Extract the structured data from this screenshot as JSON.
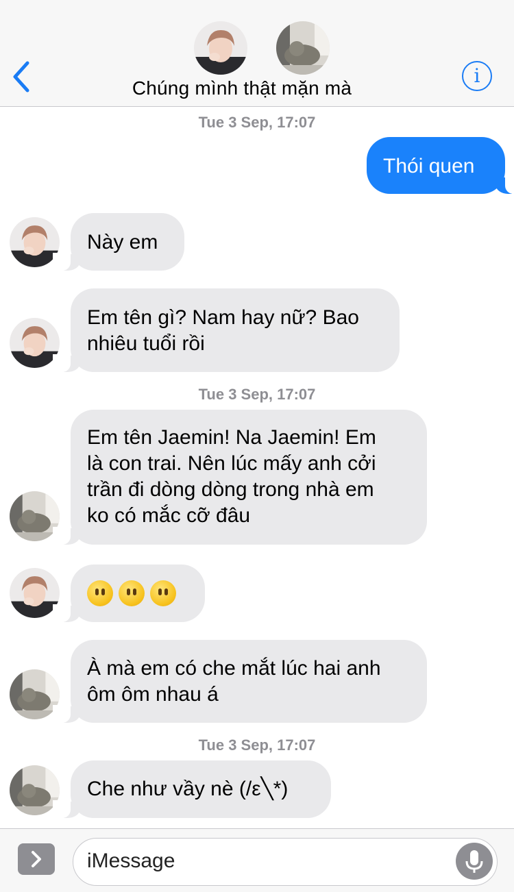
{
  "header": {
    "title": "Chúng mình thật mặn mà",
    "info_label": "i"
  },
  "colors": {
    "accent": "#1a7cf5",
    "sent_bubble": "#1a82fb",
    "received_bubble": "#e9e9eb",
    "timestamp": "#8e8e93"
  },
  "timestamps": [
    "Tue 3 Sep, 17:07",
    "Tue 3 Sep, 17:07",
    "Tue 3 Sep, 17:07"
  ],
  "messages": [
    {
      "from": "me",
      "text": "Thói quen"
    },
    {
      "from": "boy",
      "text": "Này em"
    },
    {
      "from": "boy",
      "lines": [
        "Em tên gì? Nam hay nữ? Bao",
        "nhiêu tuổi rồi"
      ]
    },
    {
      "from": "cat",
      "lines": [
        "Em tên Jaemin! Na Jaemin! Em",
        "là con trai. Nên lúc mấy anh cởi",
        "trần đi dòng dòng trong nhà em",
        "ko có mắc cỡ đâu"
      ]
    },
    {
      "from": "boy",
      "emoji": "face-without-mouth",
      "count": 3
    },
    {
      "from": "cat",
      "lines": [
        "À mà em có che mắt lúc hai anh",
        "ôm ôm nhau á"
      ]
    },
    {
      "from": "cat",
      "text": "Che như vầy nè (/ε╲*)"
    }
  ],
  "composer": {
    "placeholder": "iMessage"
  },
  "icons": {
    "back": "chevron-left-icon",
    "info": "info-icon",
    "apps": "chevron-right-icon",
    "mic": "microphone-icon"
  }
}
